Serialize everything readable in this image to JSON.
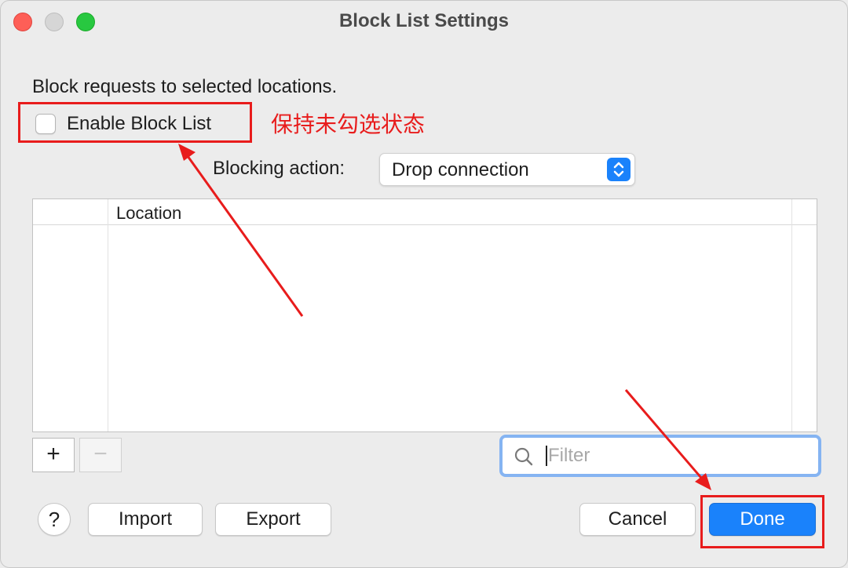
{
  "window": {
    "title": "Block List Settings"
  },
  "description": "Block requests to selected locations.",
  "enable": {
    "label": "Enable Block List",
    "checked": false
  },
  "annotation": {
    "text": "保持未勾选状态",
    "color": "#e81c1c"
  },
  "blocking": {
    "label": "Blocking action:",
    "value": "Drop connection"
  },
  "table": {
    "columns": [
      "",
      "Location"
    ],
    "rows": []
  },
  "controls": {
    "add": "+",
    "remove": "−"
  },
  "filter": {
    "placeholder": "Filter",
    "value": ""
  },
  "footer": {
    "help": "?",
    "import": "Import",
    "export": "Export",
    "cancel": "Cancel",
    "done": "Done"
  },
  "colors": {
    "accent": "#1a82fb",
    "annotation": "#e81c1c"
  }
}
